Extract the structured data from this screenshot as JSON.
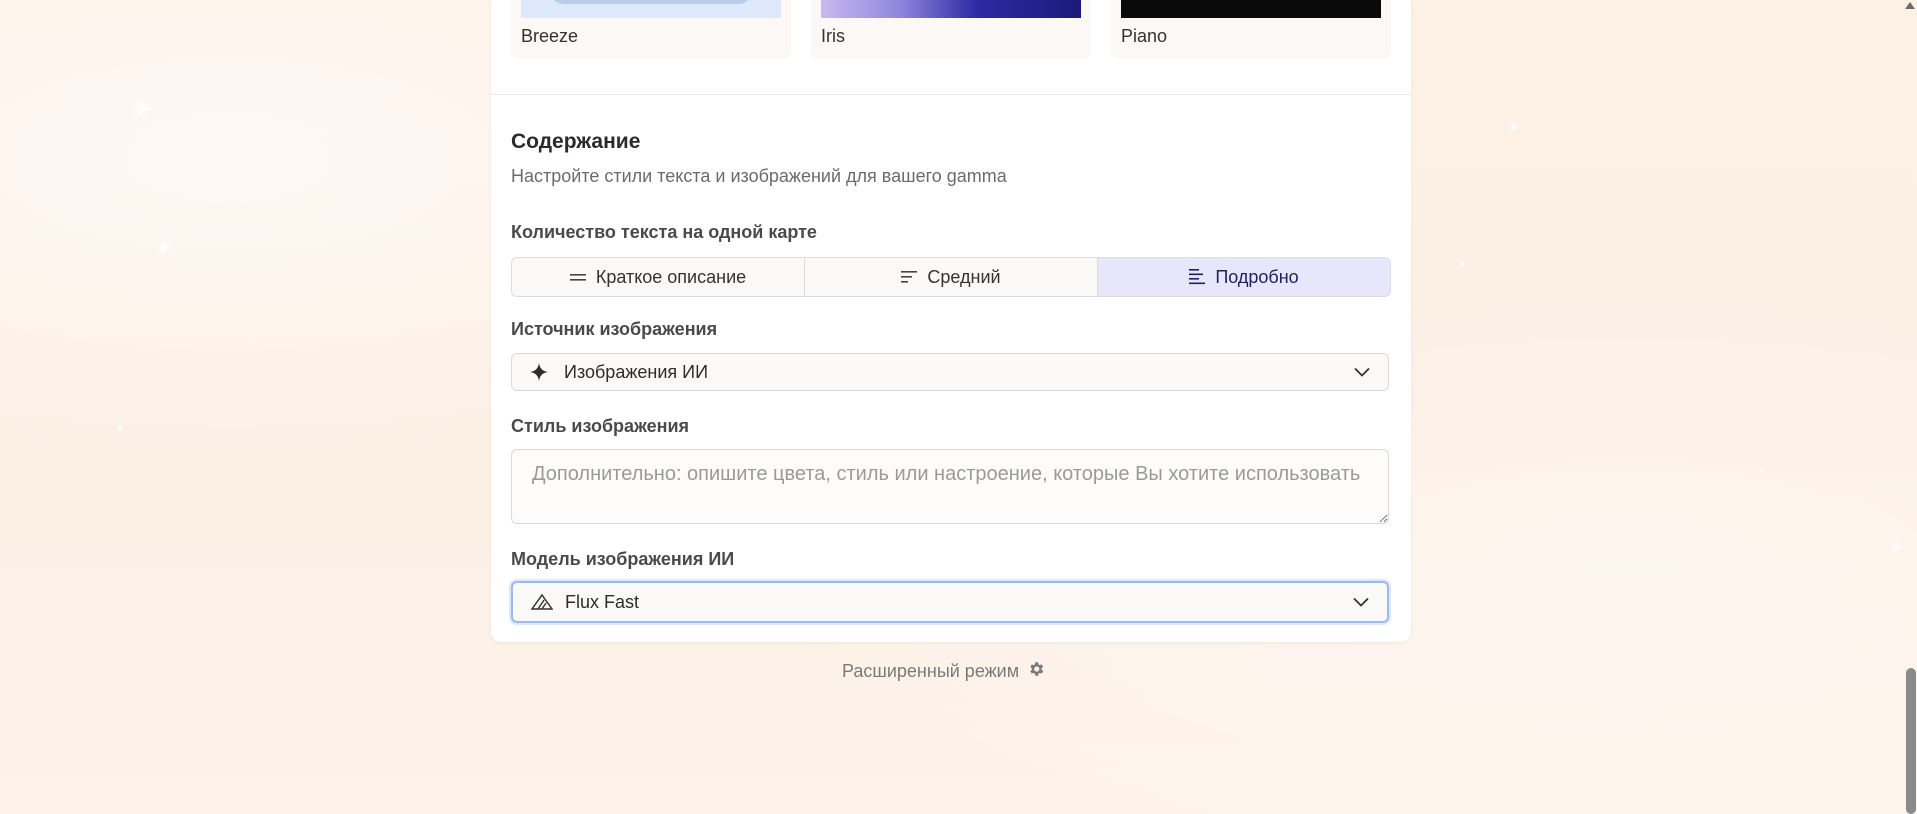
{
  "themes": [
    {
      "name": "Breeze",
      "preview": "breeze"
    },
    {
      "name": "Iris",
      "preview": "iris"
    },
    {
      "name": "Piano",
      "preview": "piano"
    }
  ],
  "content_section": {
    "title": "Содержание",
    "subtitle": "Настройте стили текста и изображений для вашего gamma"
  },
  "text_amount": {
    "label": "Количество текста на одной карте",
    "options": [
      {
        "label": "Краткое описание",
        "icon": "lines-short-icon",
        "active": false
      },
      {
        "label": "Средний",
        "icon": "lines-medium-icon",
        "active": false
      },
      {
        "label": "Подробно",
        "icon": "lines-detailed-icon",
        "active": true
      }
    ]
  },
  "image_source": {
    "label": "Источник изображения",
    "value": "Изображения ИИ",
    "icon": "sparkle-icon"
  },
  "image_style": {
    "label": "Стиль изображения",
    "placeholder": "Дополнительно: опишите цвета, стиль или настроение, которые Вы хотите использовать"
  },
  "ai_model": {
    "label": "Модель изображения ИИ",
    "value": "Flux Fast",
    "icon": "flux-triangle-icon"
  },
  "advanced": {
    "label": "Расширенный режим",
    "icon": "gear-icon"
  },
  "colors": {
    "accent_active_bg": "#e8e6fa",
    "focus_ring": "#9bbbe8",
    "background": "#fcefe3"
  }
}
